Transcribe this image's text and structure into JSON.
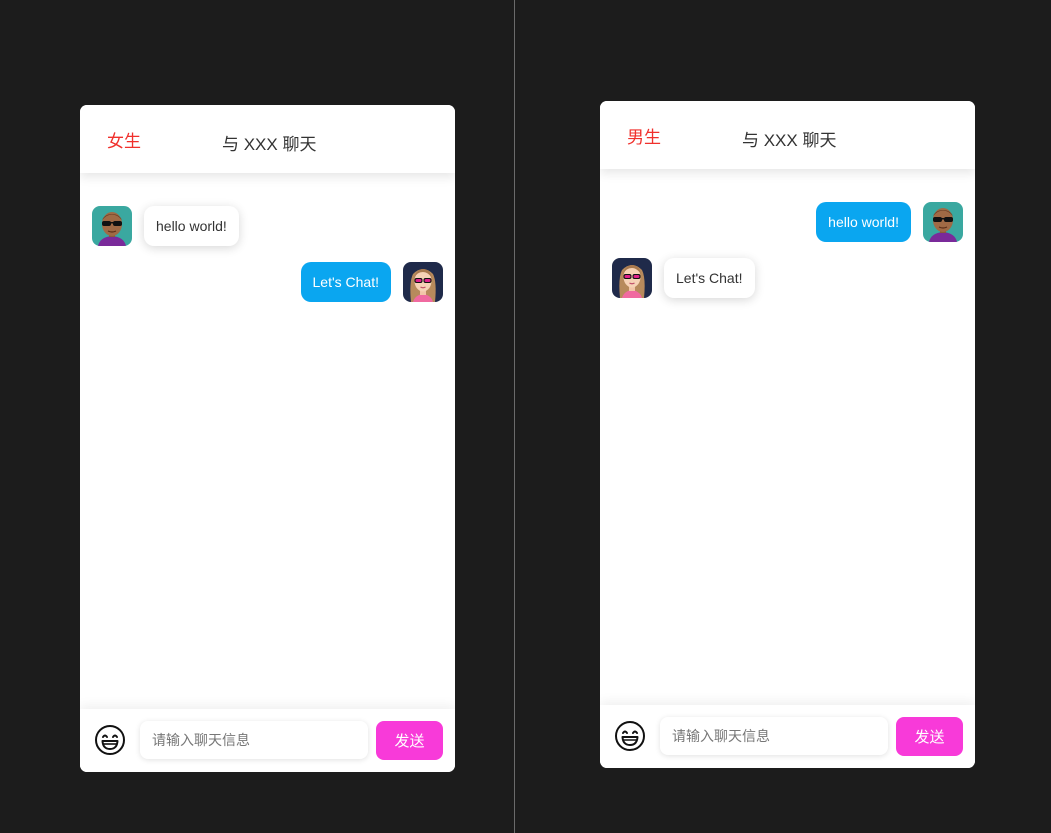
{
  "left_panel": {
    "gender_label": "女生",
    "title": "与 XXX 聊天",
    "messages": [
      {
        "side": "received",
        "text": "hello world!",
        "avatar": "male-avatar"
      },
      {
        "side": "sent",
        "text": "Let's Chat!",
        "avatar": "female-avatar"
      }
    ],
    "input_placeholder": "请输入聊天信息",
    "send_label": "发送",
    "emoji_icon": "smile-emoji-icon"
  },
  "right_panel": {
    "gender_label": "男生",
    "title": "与 XXX 聊天",
    "messages": [
      {
        "side": "sent",
        "text": "hello world!",
        "avatar": "male-avatar"
      },
      {
        "side": "received",
        "text": "Let's Chat!",
        "avatar": "female-avatar"
      }
    ],
    "input_placeholder": "请输入聊天信息",
    "send_label": "发送",
    "emoji_icon": "smile-emoji-icon"
  },
  "colors": {
    "background": "#1c1c1c",
    "gender_label": "#f0302c",
    "sent_bubble": "#0aa6f0",
    "send_button": "#f83ad9"
  }
}
